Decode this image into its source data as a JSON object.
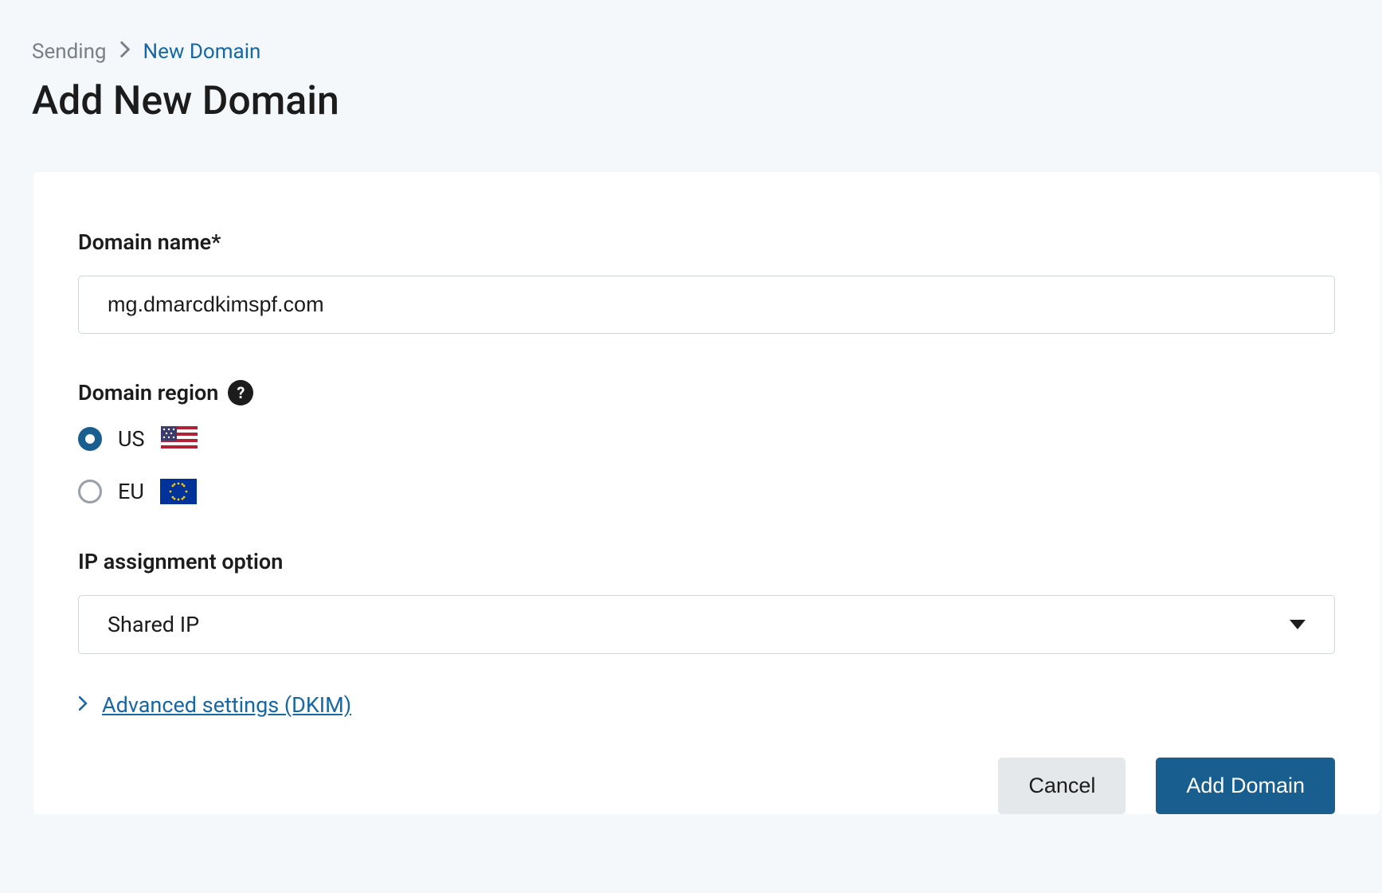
{
  "breadcrumb": {
    "parent": "Sending",
    "current": "New Domain"
  },
  "page_title": "Add New Domain",
  "form": {
    "domain_name": {
      "label": "Domain name*",
      "value": "mg.dmarcdkimspf.com"
    },
    "domain_region": {
      "label": "Domain region",
      "options": [
        {
          "label": "US",
          "selected": true
        },
        {
          "label": "EU",
          "selected": false
        }
      ]
    },
    "ip_assignment": {
      "label": "IP assignment option",
      "selected": "Shared IP"
    },
    "advanced_link": "Advanced settings (DKIM)"
  },
  "buttons": {
    "cancel": "Cancel",
    "submit": "Add Domain"
  }
}
